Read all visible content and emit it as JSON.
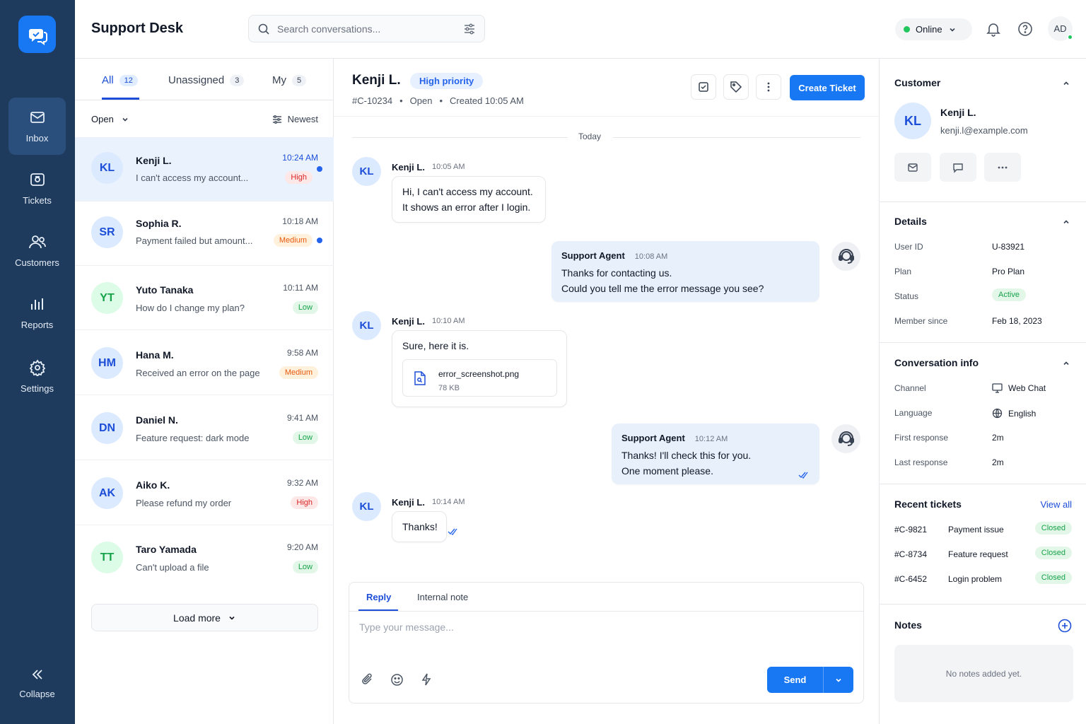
{
  "app": {
    "title": "Support Desk"
  },
  "search": {
    "placeholder": "Search conversations..."
  },
  "status": {
    "label": "Online"
  },
  "user": {
    "initials": "AD"
  },
  "sidebar": {
    "items": [
      {
        "label": "Inbox",
        "icon": "mail-icon"
      },
      {
        "label": "Tickets",
        "icon": "ticket-icon"
      },
      {
        "label": "Customers",
        "icon": "users-icon"
      },
      {
        "label": "Reports",
        "icon": "bar-chart-icon"
      },
      {
        "label": "Settings",
        "icon": "gear-icon"
      }
    ],
    "collapse_label": "Collapse"
  },
  "inbox": {
    "tabs": [
      {
        "label": "All",
        "count": "12"
      },
      {
        "label": "Unassigned",
        "count": "3"
      },
      {
        "label": "My",
        "count": "5"
      }
    ],
    "filter_label": "Open",
    "sort_label": "Newest",
    "conversations": [
      {
        "initials": "KL",
        "name": "Kenji L.",
        "preview": "I can't access my account...",
        "time": "10:24 AM",
        "priority": "High"
      },
      {
        "initials": "SR",
        "name": "Sophia R.",
        "preview": "Payment failed but amount...",
        "time": "10:18 AM",
        "priority": "Medium"
      },
      {
        "initials": "YT",
        "name": "Yuto Tanaka",
        "preview": "How do I change my plan?",
        "time": "10:11 AM",
        "priority": "Low"
      },
      {
        "initials": "HM",
        "name": "Hana M.",
        "preview": "Received an error on the page",
        "time": "9:58 AM",
        "priority": "Medium"
      },
      {
        "initials": "DN",
        "name": "Daniel N.",
        "preview": "Feature request: dark mode",
        "time": "9:41 AM",
        "priority": "Low"
      },
      {
        "initials": "AK",
        "name": "Aiko K.",
        "preview": "Please refund my order",
        "time": "9:32 AM",
        "priority": "High"
      },
      {
        "initials": "TT",
        "name": "Taro Yamada",
        "preview": "Can't upload a file",
        "time": "9:20 AM",
        "priority": "Low"
      }
    ],
    "load_more": "Load more"
  },
  "chat": {
    "name": "Kenji L.",
    "priority_badge": "High priority",
    "ticket_id": "#C-10234",
    "ticket_status": "Open",
    "created": "Created 10:05 AM",
    "create_ticket": "Create Ticket",
    "day_divider": "Today",
    "messages": [
      {
        "from": "Kenji L.",
        "initials": "KL",
        "time": "10:05 AM",
        "lines": [
          "Hi, I can't access my account.",
          "It shows an error after I login."
        ]
      },
      {
        "from": "Support Agent",
        "time": "10:08 AM",
        "lines": [
          "Thanks for contacting us.",
          "Could you tell me the error message you see?"
        ]
      },
      {
        "from": "Kenji L.",
        "initials": "KL",
        "time": "10:10 AM",
        "lines": [
          "Sure, here it is."
        ],
        "attachment": {
          "name": "error_screenshot.png",
          "size": "78 KB"
        }
      },
      {
        "from": "Support Agent",
        "time": "10:12 AM",
        "lines": [
          "Thanks! I'll check this for you.",
          "One moment please."
        ]
      },
      {
        "from": "Kenji L.",
        "initials": "KL",
        "time": "10:14 AM",
        "lines": [
          "Thanks!"
        ]
      }
    ],
    "composer": {
      "tabs": [
        "Reply",
        "Internal note"
      ],
      "placeholder": "Type your message...",
      "send": "Send"
    }
  },
  "customer": {
    "section_title": "Customer",
    "initials": "KL",
    "name": "Kenji L.",
    "email": "kenji.l@example.com",
    "details_title": "Details",
    "details": [
      {
        "label": "User ID",
        "value": "U-83921"
      },
      {
        "label": "Plan",
        "value": "Pro Plan"
      },
      {
        "label": "Status",
        "value": "Active"
      },
      {
        "label": "Member since",
        "value": "Feb 18, 2023"
      }
    ],
    "conv_info_title": "Conversation info",
    "conv_info": [
      {
        "label": "Channel",
        "value": "Web Chat",
        "icon": "monitor-icon"
      },
      {
        "label": "Language",
        "value": "English",
        "icon": "globe-icon"
      },
      {
        "label": "First response",
        "value": "2m"
      },
      {
        "label": "Last response",
        "value": "2m"
      }
    ],
    "recent_title": "Recent tickets",
    "view_all": "View all",
    "recent": [
      {
        "id": "#C-9821",
        "subject": "Payment issue",
        "status": "Closed"
      },
      {
        "id": "#C-8734",
        "subject": "Feature request",
        "status": "Closed"
      },
      {
        "id": "#C-6452",
        "subject": "Login problem",
        "status": "Closed"
      }
    ],
    "notes_title": "Notes",
    "notes_empty": "No notes added yet."
  },
  "colors": {
    "accent": "#1877f2",
    "rail": "#1e3a5c",
    "high": "#dc2626",
    "medium": "#ea580c",
    "low": "#16a34a"
  }
}
